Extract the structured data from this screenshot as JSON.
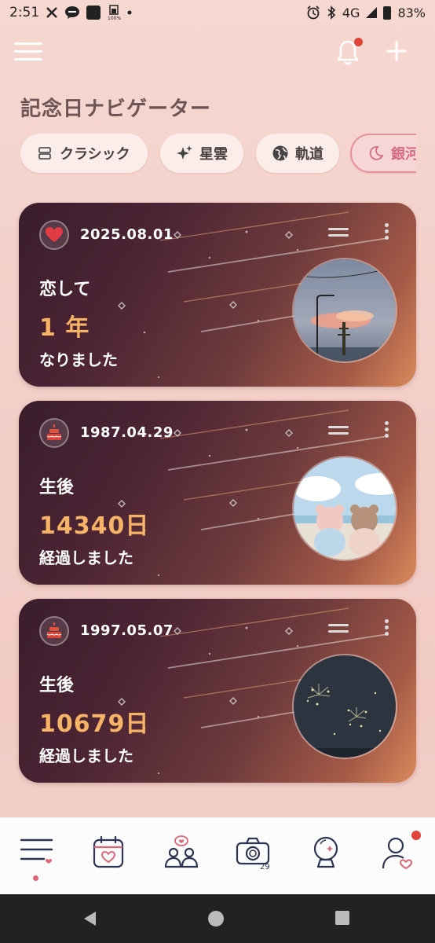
{
  "status_bar": {
    "time": "2:51",
    "network": "4G",
    "battery": "83%",
    "icons": [
      "x-logo-icon",
      "chat-icon",
      "app-square-icon",
      "battery-saver-icon",
      "dot-icon",
      "alarm-icon",
      "bluetooth-icon",
      "signal-icon",
      "battery-icon"
    ]
  },
  "header": {
    "title": "記念日ナビゲーター",
    "menu_icon": "hamburger-icon",
    "notification_icon": "bell-icon",
    "add_icon": "plus-icon"
  },
  "themes": [
    {
      "label": "クラシック",
      "icon": "list-icon",
      "active": false
    },
    {
      "label": "星雲",
      "icon": "sparkle-icon",
      "active": false
    },
    {
      "label": "軌道",
      "icon": "globe-icon",
      "active": false
    },
    {
      "label": "銀河",
      "icon": "moon-icon",
      "active": true
    }
  ],
  "cards": [
    {
      "date": "2025.08.01",
      "badge_icon": "heart-icon",
      "line1": "恋して",
      "count": "1 年",
      "line3": "なりました",
      "photo": "sunset-sky-photo"
    },
    {
      "date": "1987.04.29",
      "badge_icon": "cake-icon",
      "line1": "生後",
      "count": "14340日",
      "line3": "経過しました",
      "photo": "teddy-bears-photo"
    },
    {
      "date": "1997.05.07",
      "badge_icon": "cake-icon",
      "line1": "生後",
      "count": "10679日",
      "line3": "経過しました",
      "photo": "fireworks-photo"
    }
  ],
  "bottom_nav": [
    {
      "icon": "list-heart-icon",
      "active": true
    },
    {
      "icon": "calendar-heart-icon",
      "active": false
    },
    {
      "icon": "couple-icon",
      "active": false
    },
    {
      "icon": "camera-icon",
      "active": false,
      "badge_text": "29"
    },
    {
      "icon": "crystal-ball-icon",
      "active": false
    },
    {
      "icon": "profile-heart-icon",
      "active": false,
      "has_dot": true
    }
  ],
  "colors": {
    "accent": "#e06576",
    "count_text": "#f7b467",
    "card_start": "#3a1d2c",
    "card_end": "#d98a5b",
    "background": "#f4d3cc",
    "notification_dot": "#e0443a"
  }
}
